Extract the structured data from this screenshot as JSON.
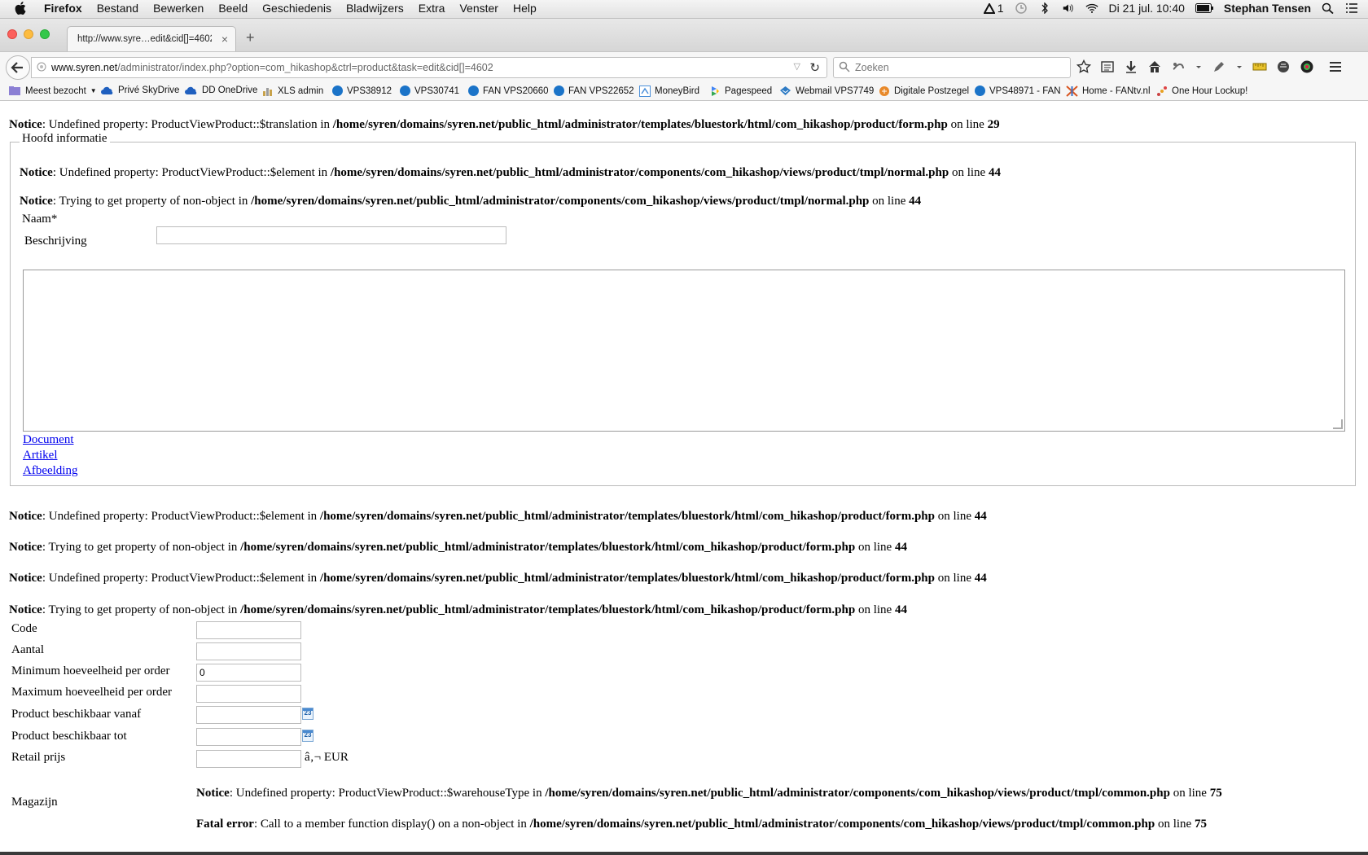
{
  "menubar": {
    "app": "Firefox",
    "items": [
      "Bestand",
      "Bewerken",
      "Beeld",
      "Geschiedenis",
      "Bladwijzers",
      "Extra",
      "Venster",
      "Help"
    ],
    "adobe_badge": "1",
    "datetime": "Di 21 jul.  10:40",
    "user": "Stephan Tensen"
  },
  "tab": {
    "title": "http://www.syre…edit&cid[]=4602"
  },
  "url": {
    "domain": "www.syren.net",
    "path": "/administrator/index.php?option=com_hikashop&ctrl=product&task=edit&cid[]=4602"
  },
  "search": {
    "placeholder": "Zoeken"
  },
  "bookmarks": [
    "Meest bezocht",
    "Privé SkyDrive",
    "DD OneDrive",
    "XLS admin",
    "VPS38912",
    "VPS30741",
    "FAN VPS20660",
    "FAN VPS22652",
    "MoneyBird",
    "Pagespeed",
    "Webmail VPS7749",
    "Digitale Postzegel",
    "VPS48971 - FAN",
    "Home - FANtv.nl",
    "One Hour Lockup!"
  ],
  "notices": {
    "n1": {
      "label": "Notice",
      "msg": ": Undefined property: ProductViewProduct::$translation in ",
      "file": "/home/syren/domains/syren.net/public_html/administrator/templates/bluestork/html/com_hikashop/product/form.php",
      "online": " on line ",
      "line": "29"
    },
    "n2": {
      "label": "Notice",
      "msg": ": Undefined property: ProductViewProduct::$element in ",
      "file": "/home/syren/domains/syren.net/public_html/administrator/components/com_hikashop/views/product/tmpl/normal.php",
      "online": " on line ",
      "line": "44"
    },
    "n3": {
      "label": "Notice",
      "msg": ": Trying to get property of non-object in ",
      "file": "/home/syren/domains/syren.net/public_html/administrator/components/com_hikashop/views/product/tmpl/normal.php",
      "online": " on line ",
      "line": "44"
    },
    "n4": {
      "label": "Notice",
      "msg": ": Undefined property: ProductViewProduct::$element in ",
      "file": "/home/syren/domains/syren.net/public_html/administrator/templates/bluestork/html/com_hikashop/product/form.php",
      "online": " on line ",
      "line": "44"
    },
    "n5": {
      "label": "Notice",
      "msg": ": Trying to get property of non-object in ",
      "file": "/home/syren/domains/syren.net/public_html/administrator/templates/bluestork/html/com_hikashop/product/form.php",
      "online": " on line ",
      "line": "44"
    },
    "n6": {
      "label": "Notice",
      "msg": ": Undefined property: ProductViewProduct::$element in ",
      "file": "/home/syren/domains/syren.net/public_html/administrator/templates/bluestork/html/com_hikashop/product/form.php",
      "online": " on line ",
      "line": "44"
    },
    "n7": {
      "label": "Notice",
      "msg": ": Trying to get property of non-object in ",
      "file": "/home/syren/domains/syren.net/public_html/administrator/templates/bluestork/html/com_hikashop/product/form.php",
      "online": " on line ",
      "line": "44"
    },
    "n8": {
      "label": "Notice",
      "msg": ": Undefined property: ProductViewProduct::$warehouseType in ",
      "file": "/home/syren/domains/syren.net/public_html/administrator/components/com_hikashop/views/product/tmpl/common.php",
      "online": " on line ",
      "line": "75"
    },
    "n9": {
      "label": "Fatal error",
      "msg": ": Call to a member function display() on a non-object in ",
      "file": "/home/syren/domains/syren.net/public_html/administrator/components/com_hikashop/views/product/tmpl/common.php",
      "online": " on line ",
      "line": "75"
    }
  },
  "form": {
    "legend": "Hoofd informatie",
    "naam_label": "Naam*",
    "naam_value": "",
    "beschrijving_label": "Beschrijving",
    "links": [
      "Document",
      "Artikel",
      "Afbeelding"
    ],
    "code_label": "Code",
    "aantal_label": "Aantal",
    "min_label": "Minimum hoeveelheid per order",
    "min_value": "0",
    "max_label": "Maximum hoeveelheid per order",
    "vanaf_label": "Product beschikbaar vanaf",
    "tot_label": "Product beschikbaar tot",
    "calendar_text": "23",
    "prijs_label": "Retail prijs",
    "currency": "â‚¬ EUR",
    "magazijn_label": "Magazijn"
  }
}
